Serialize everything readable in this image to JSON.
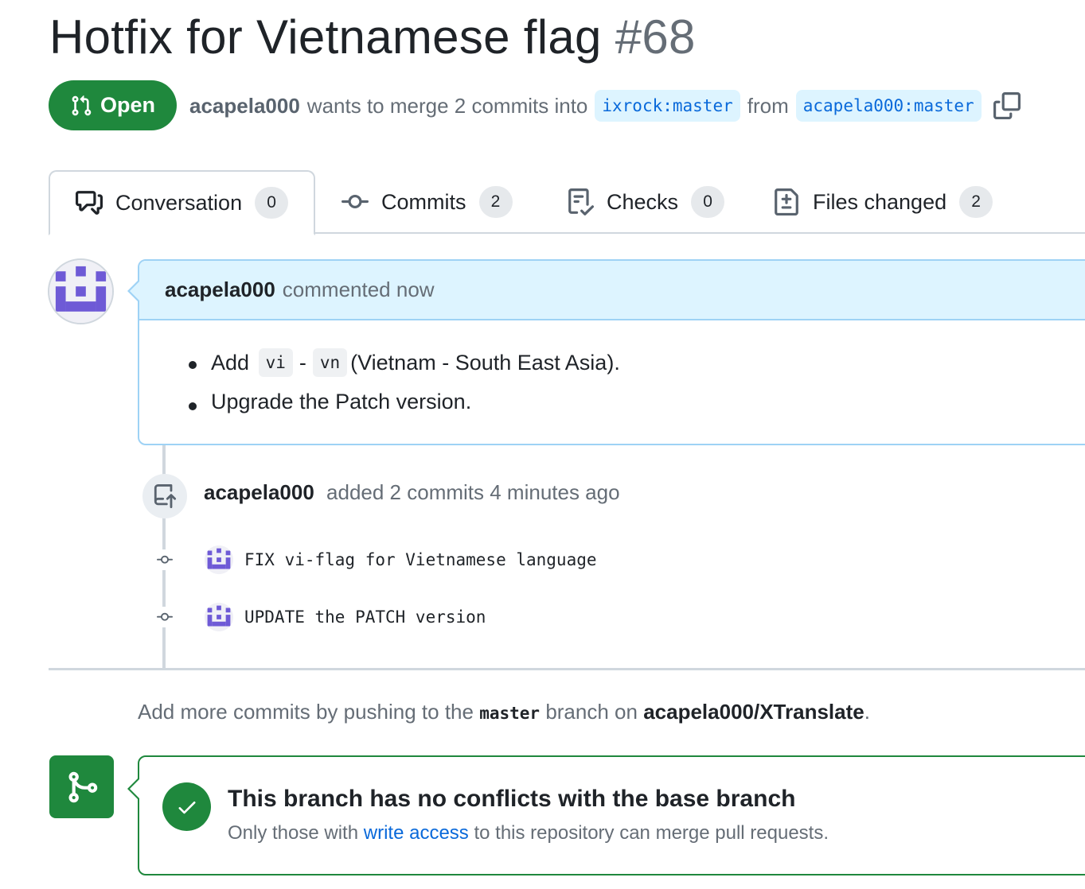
{
  "pr": {
    "title": "Hotfix for Vietnamese flag",
    "number": "#68",
    "state": "Open",
    "author": "acapela000",
    "merge_text": "wants to merge 2 commits into",
    "base_branch": "ixrock:master",
    "from_text": "from",
    "head_branch": "acapela000:master",
    "copy_icon": "copy-icon"
  },
  "tabs": [
    {
      "label": "Conversation",
      "count": "0",
      "icon": "comment-discussion-icon"
    },
    {
      "label": "Commits",
      "count": "2",
      "icon": "git-commit-icon"
    },
    {
      "label": "Checks",
      "count": "0",
      "icon": "checklist-icon"
    },
    {
      "label": "Files changed",
      "count": "2",
      "icon": "file-diff-icon"
    }
  ],
  "comment": {
    "author": "acapela000",
    "action": "commented now",
    "item1": {
      "prefix": "Add",
      "code1": "vi",
      "sep": "-",
      "code2": "vn",
      "suffix": "(Vietnam - South East Asia)."
    },
    "item2": "Upgrade the Patch version."
  },
  "push_event": {
    "author": "acapela000",
    "text": "added 2 commits 4 minutes ago"
  },
  "commits": [
    {
      "message": "FIX vi-flag for Vietnamese language"
    },
    {
      "message": "UPDATE the PATCH version"
    }
  ],
  "hint": {
    "prefix": "Add more commits by pushing to the",
    "branch": "master",
    "middle": "branch on",
    "repo": "acapela000/XTranslate",
    "suffix": "."
  },
  "merge": {
    "title": "This branch has no conflicts with the base branch",
    "sub_prefix": "Only those with",
    "sub_link": "write access",
    "sub_suffix": "to this repository can merge pull requests."
  },
  "colors": {
    "green": "#1f883d",
    "blue_link": "#0969da",
    "comment_header_bg": "#ddf4ff",
    "avatar_purple": "#6e5ad6"
  }
}
